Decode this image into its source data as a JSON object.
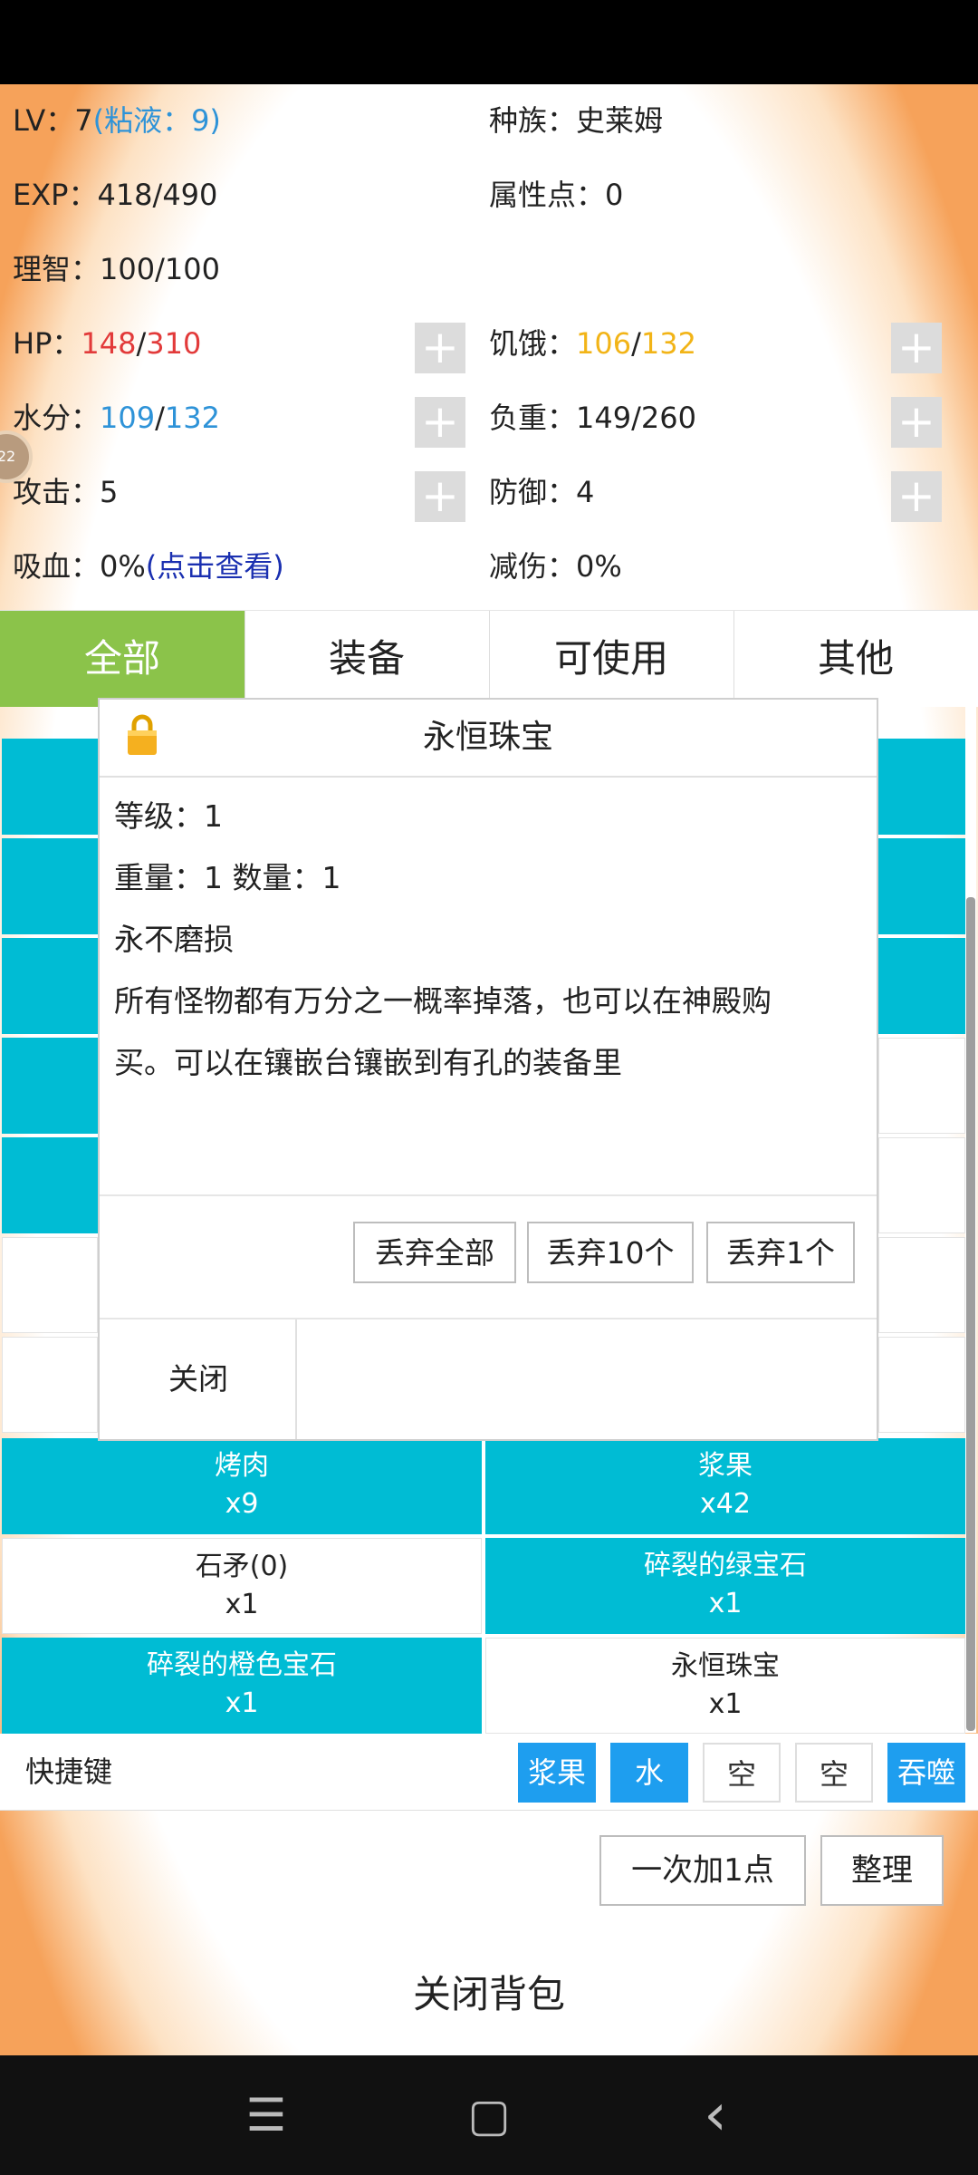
{
  "stats": {
    "lv_label": "LV：",
    "lv_value": "7",
    "lv_extra": "(粘液：9)",
    "race_label": "种族：",
    "race_value": "史莱姆",
    "exp_label": "EXP：",
    "exp_value": "418/490",
    "attr_label": "属性点：",
    "attr_value": "0",
    "reason_label": "理智：",
    "reason_value": "100/100",
    "hp_label": "HP：",
    "hp_cur": "148",
    "hp_max": "310",
    "hunger_label": "饥饿：",
    "hunger_cur": "106",
    "hunger_max": "132",
    "water_label": "水分：",
    "water_cur": "109",
    "water_max": "132",
    "load_label": "负重：",
    "load_value": "149/260",
    "atk_label": "攻击：",
    "atk_value": "5",
    "def_label": "防御：",
    "def_value": "4",
    "leech_label": "吸血：",
    "leech_value": "0%",
    "leech_link": "(点击查看)",
    "reduce_label": "减伤：",
    "reduce_value": "0%",
    "plus_symbol": "+"
  },
  "tabs": [
    "全部",
    "装备",
    "可使用",
    "其他"
  ],
  "inventory": [
    {
      "name": "烤肉",
      "qty": "x9",
      "color": "#00bcd4"
    },
    {
      "name": "浆果",
      "qty": "x42",
      "color": "#00bcd4"
    },
    {
      "name": "石矛(0)",
      "qty": "x1",
      "color": "#ffffff"
    },
    {
      "name": "碎裂的绿宝石",
      "qty": "x1",
      "color": "#00bcd4"
    },
    {
      "name": "碎裂的橙色宝石",
      "qty": "x1",
      "color": "#00bcd4"
    },
    {
      "name": "永恒珠宝",
      "qty": "x1",
      "color": "#ffffff"
    }
  ],
  "dialog": {
    "title": "永恒珠宝",
    "level": "等级：1",
    "weight_count": "重量：1  数量：1",
    "durability": "永不磨损",
    "desc_line1": "所有怪物都有万分之一概率掉落，也可以在神殿购",
    "desc_line2": "买。可以在镶嵌台镶嵌到有孔的装备里",
    "discard_all": "丢弃全部",
    "discard_10": "丢弃10个",
    "discard_1": "丢弃1个",
    "close": "关闭"
  },
  "shortcuts": {
    "label": "快捷键",
    "slots": [
      "浆果",
      "水",
      "空",
      "空",
      "吞噬"
    ]
  },
  "actions": {
    "add_one": "一次加1点",
    "sort": "整理",
    "close_bag": "关闭背包"
  },
  "float_ball": "22",
  "nav": {
    "menu": "☰",
    "home": "▢",
    "back": "‹"
  }
}
